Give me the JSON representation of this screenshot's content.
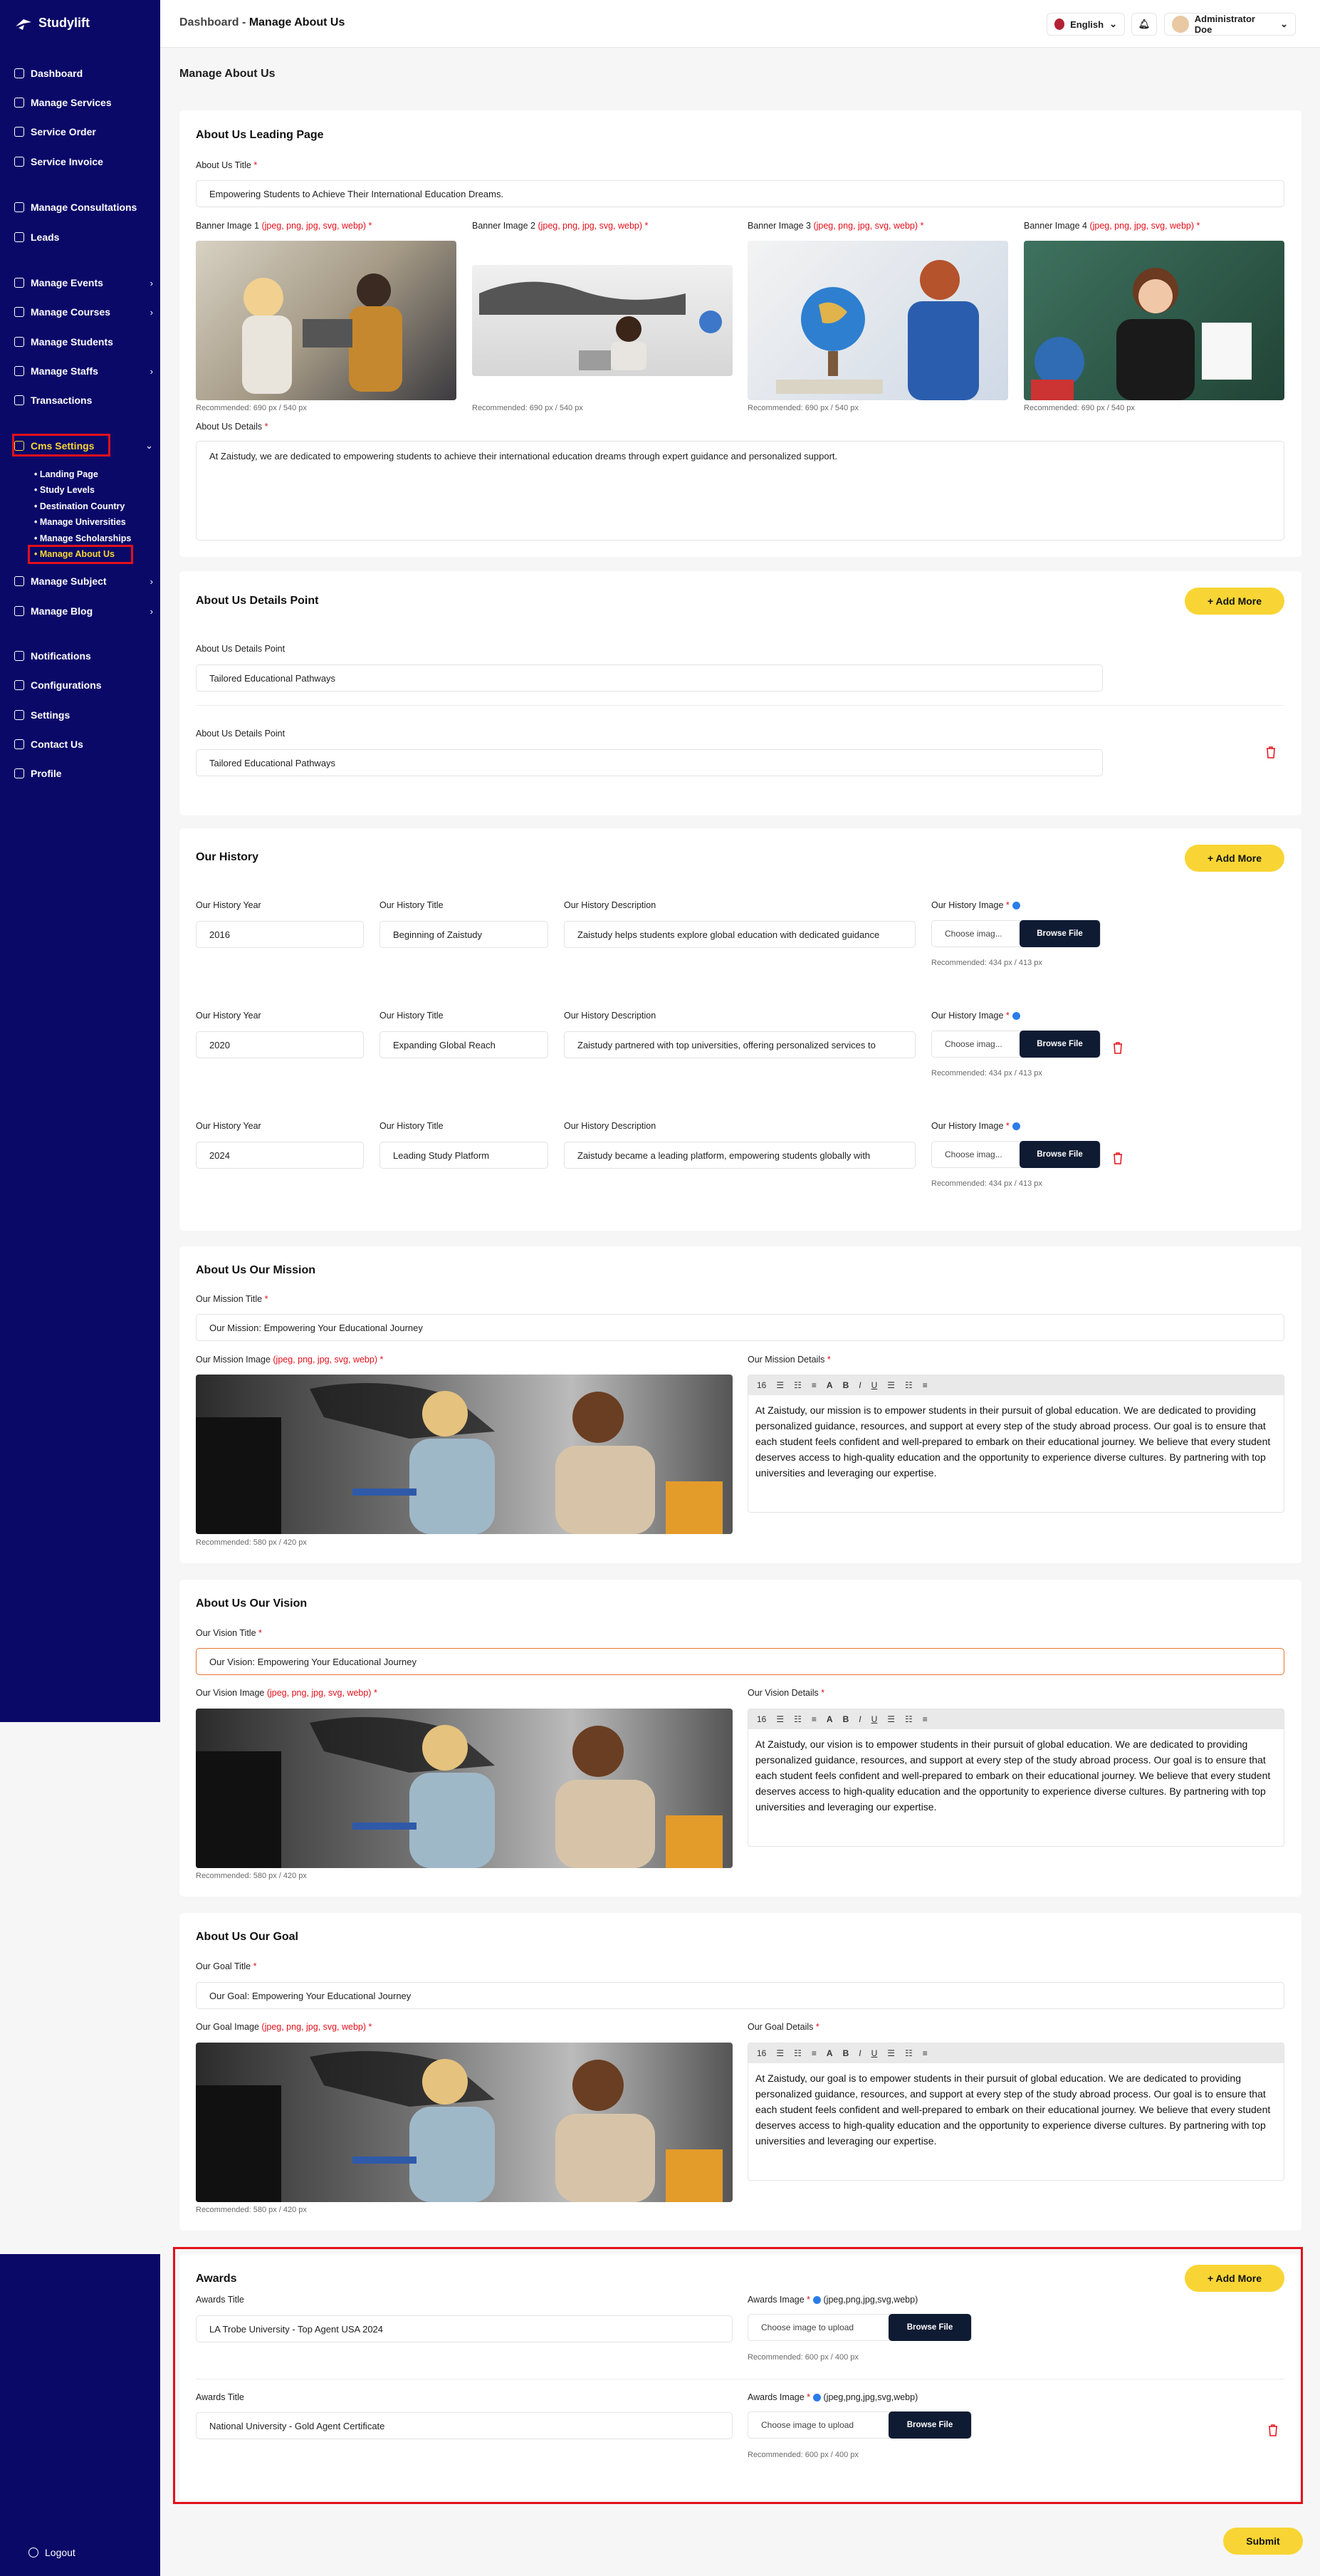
{
  "app": {
    "name": "Studylift"
  },
  "sidebar": {
    "items": [
      {
        "label": "Dashboard"
      },
      {
        "label": "Manage Services"
      },
      {
        "label": "Service Order"
      },
      {
        "label": "Service Invoice"
      },
      {
        "label": "Manage Consultations"
      },
      {
        "label": "Leads"
      },
      {
        "label": "Manage Events"
      },
      {
        "label": "Manage Courses"
      },
      {
        "label": "Manage Students"
      },
      {
        "label": "Manage Staffs"
      },
      {
        "label": "Transactions"
      },
      {
        "label": "Cms Settings"
      },
      {
        "label": "Manage Subject"
      },
      {
        "label": "Manage Blog"
      },
      {
        "label": "Notifications"
      },
      {
        "label": "Configurations"
      },
      {
        "label": "Settings"
      },
      {
        "label": "Contact Us"
      },
      {
        "label": "Profile"
      }
    ],
    "cms_sub": [
      "Landing Page",
      "Study Levels",
      "Destination Country",
      "Manage Universities",
      "Manage Scholarships",
      "Manage About Us"
    ],
    "logout": "Logout"
  },
  "header": {
    "crumb_parent": "Dashboard",
    "crumb_sep": "-",
    "crumb_current": "Manage About Us",
    "language": "English",
    "user": "Administrator Doe"
  },
  "page": {
    "title": "Manage About Us",
    "submit": "Submit"
  },
  "leading": {
    "title": "About Us Leading Page",
    "about_title_label": "About Us Title",
    "about_title_value": "Empowering Students to Achieve Their International Education Dreams.",
    "banners": [
      {
        "label": "Banner Image 1",
        "ext": "(jpeg, png, jpg, svg, webp)",
        "hint": "Recommended: 690 px / 540 px"
      },
      {
        "label": "Banner Image 2",
        "ext": "(jpeg, png, jpg, svg, webp)",
        "hint": "Recommended: 690 px / 540 px"
      },
      {
        "label": "Banner Image 3",
        "ext": "(jpeg, png, jpg, svg, webp)",
        "hint": "Recommended: 690 px / 540 px"
      },
      {
        "label": "Banner Image 4",
        "ext": "(jpeg, png, jpg, svg, webp)",
        "hint": "Recommended: 690 px / 540 px"
      }
    ],
    "details_label": "About Us Details",
    "details_value": "At Zaistudy, we are dedicated to empowering students to achieve their international education dreams through expert guidance and personalized support."
  },
  "points": {
    "title": "About Us Details Point",
    "add": "+ Add More",
    "rows": [
      {
        "label": "About Us Details Point",
        "value": "Tailored Educational Pathways"
      },
      {
        "label": "About Us Details Point",
        "value": "Tailored Educational Pathways"
      }
    ]
  },
  "history": {
    "title": "Our History",
    "add": "+ Add More",
    "labels": {
      "year": "Our History Year",
      "title": "Our History Title",
      "desc": "Our History Description",
      "image": "Our History Image"
    },
    "choose": "Choose imag...",
    "browse": "Browse File",
    "hint": "Recommended: 434 px / 413 px",
    "rows": [
      {
        "year": "2016",
        "title": "Beginning of Zaistudy",
        "desc": "Zaistudy helps students explore global education with dedicated guidance"
      },
      {
        "year": "2020",
        "title": "Expanding Global Reach",
        "desc": "Zaistudy partnered with top universities, offering personalized services to"
      },
      {
        "year": "2024",
        "title": "Leading Study Platform",
        "desc": "Zaistudy became a leading platform, empowering students globally with"
      }
    ]
  },
  "mission": {
    "title": "About Us Our Mission",
    "field_label": "Our Mission Title",
    "field_value": "Our Mission: Empowering Your  Educational Journey",
    "image_label": "Our Mission Image",
    "image_ext": "(jpeg, png, jpg, svg, webp)",
    "details_label": "Our Mission Details",
    "details_text": "At Zaistudy, our mission is to empower students in their pursuit of global education. We are dedicated to providing personalized guidance, resources, and support at every step of the study abroad process. Our goal is to ensure that each student feels confident and well-prepared to embark on their educational journey. We believe that every student deserves access to high-quality education and the opportunity to experience diverse cultures. By partnering with top universities and leveraging our expertise.",
    "hint": "Recommended: 580 px / 420 px"
  },
  "vision": {
    "title": "About Us Our Vision",
    "field_label": "Our Vision Title",
    "field_value": "Our Vision: Empowering Your  Educational Journey",
    "image_label": "Our Vision Image",
    "image_ext": "(jpeg, png, jpg, svg, webp)",
    "details_label": "Our Vision Details",
    "details_text": "At Zaistudy, our vision is to empower students in their pursuit of global education. We are dedicated to providing personalized guidance, resources, and support at every step of the study abroad process. Our goal is to ensure that each student feels confident and well-prepared to embark on their educational journey. We believe that every student deserves access to high-quality education and the opportunity to experience diverse cultures. By partnering with top universities and leveraging our expertise.",
    "hint": "Recommended: 580 px / 420 px"
  },
  "goal": {
    "title": "About Us Our Goal",
    "field_label": "Our Goal Title",
    "field_value": "Our Goal: Empowering Your  Educational Journey",
    "image_label": "Our Goal Image",
    "image_ext": "(jpeg, png, jpg, svg, webp)",
    "details_label": "Our Goal Details",
    "details_text": "At Zaistudy, our goal is to empower students in their pursuit of global education. We are dedicated to providing personalized guidance, resources, and support at every step of the study abroad process. Our goal is to ensure that each student feels confident and well-prepared to embark on their educational journey. We believe that every student deserves access to high-quality education and the opportunity to experience diverse cultures. By partnering with top universities and leveraging our expertise.",
    "hint": "Recommended: 580 px / 420 px"
  },
  "editor": {
    "font_size": "16"
  },
  "awards": {
    "title": "Awards",
    "add": "+ Add More",
    "title_label": "Awards Title",
    "image_label": "Awards Image",
    "image_ext": "(jpeg,png,jpg,svg,webp)",
    "choose": "Choose image to upload",
    "browse": "Browse File",
    "hint": "Recommended: 600 px / 400 px",
    "rows": [
      {
        "value": "LA Trobe University -  Top Agent USA 2024"
      },
      {
        "value": "National University -  Gold Agent Certificate"
      }
    ]
  },
  "colors": {
    "sidebar": "#0b0968",
    "accent": "#f8d534",
    "highlight": "#e3101b",
    "browse": "#0f1b33"
  }
}
